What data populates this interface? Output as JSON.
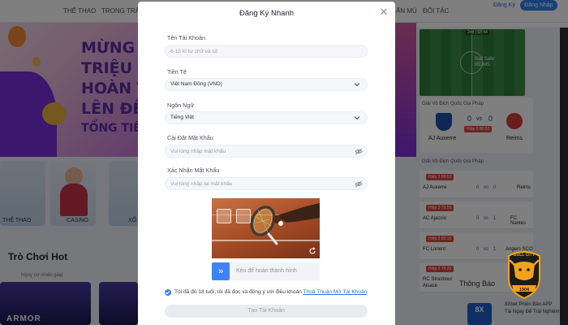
{
  "background": {
    "nav": {
      "items": [
        "THỂ THAO",
        "TRONG TRẬN",
        "ẨN MÙ",
        "ĐỐI TÁC"
      ],
      "login_link": "Đăng Ký",
      "login_button": "Đăng Nhập"
    },
    "banner": {
      "lines": [
        "MỪNG T",
        "TRIỆU",
        "HOÀN T",
        "LÊN ĐẾ",
        "TỔNG TIỀ"
      ]
    },
    "categories": [
      "THỂ THAO",
      "CASINO",
      "XỔ"
    ],
    "hot": {
      "title": "Trò Chơi Hot",
      "subtitle": "Nguy cơ chiến giáp",
      "card_text": "ARMOR"
    },
    "side": {
      "pitch_timer": "2nd | 68:44",
      "pitch_text": "Ball Safe\nREIMS",
      "featured": {
        "league": "Giải Vô Địch Quốc Gia Pháp",
        "home": "AJ Auxerre",
        "away": "Reims",
        "home_score": "0",
        "vs": "vs",
        "away_score": "0",
        "badge": "Hiệp 2 80:52"
      },
      "league2": "Giải Vô Địch Quốc Gia Pháp",
      "matches": [
        {
          "badge": "Hiệp 2 80:52",
          "home": "AJ Auxerre",
          "away": "Reims",
          "h": "0",
          "vs": "vs",
          "a": "0"
        },
        {
          "badge": "Hiệp 2 79:55",
          "home": "AC Ajaccio",
          "away": "FC Nantes",
          "h": "0",
          "vs": "vs",
          "a": "1"
        },
        {
          "badge": "Hiệp 2 82:15",
          "home": "FC Lorient",
          "away": "Angers SCO",
          "h": "0",
          "vs": "vs",
          "a": "1"
        },
        {
          "badge": "Hiệp 2 79:22",
          "home": "RC Strasbour\nAlsace",
          "away": "",
          "h": "",
          "vs": "",
          "a": ""
        }
      ],
      "notice": "Thông Báo",
      "promo_a": "8Xbet Phiên Bản APP",
      "promo_b": "Tải Ngay Để Trải Nghiệm",
      "logo_8x": "8X",
      "bull_label": "BULL CITY",
      "bull_year": "1904"
    }
  },
  "modal": {
    "title": "Đăng Ký Nhanh",
    "close_icon": "close-icon",
    "fields": {
      "account": {
        "label": "Tên Tài Khoản",
        "placeholder": "6-15 kí tự chữ và số"
      },
      "currency": {
        "label": "Tiền Tệ",
        "value": "Việt Nam Đồng (VND)"
      },
      "language": {
        "label": "Ngôn Ngữ",
        "value": "Tiếng Việt"
      },
      "password": {
        "label": "Cài Đặt Mật Khẩu",
        "placeholder": "Vui lòng nhập mật khẩu"
      },
      "confirm": {
        "label": "Xác Nhận Mật Khẩu",
        "placeholder": "Vui lòng nhập lại mật khẩu"
      }
    },
    "captcha": {
      "slider_text": "Kéo để hoàn thành hình",
      "handle_glyph": "»"
    },
    "terms": {
      "text": "Tôi đã đủ 18 tuổi, tôi đã đọc và đồng ý với điều khoản",
      "link": "Thoả Thuận Mở Tài Khoản"
    },
    "submit": "Tạo Tài Khoản",
    "colors": {
      "accent": "#3e82f7",
      "link": "#2d6fe0"
    }
  }
}
